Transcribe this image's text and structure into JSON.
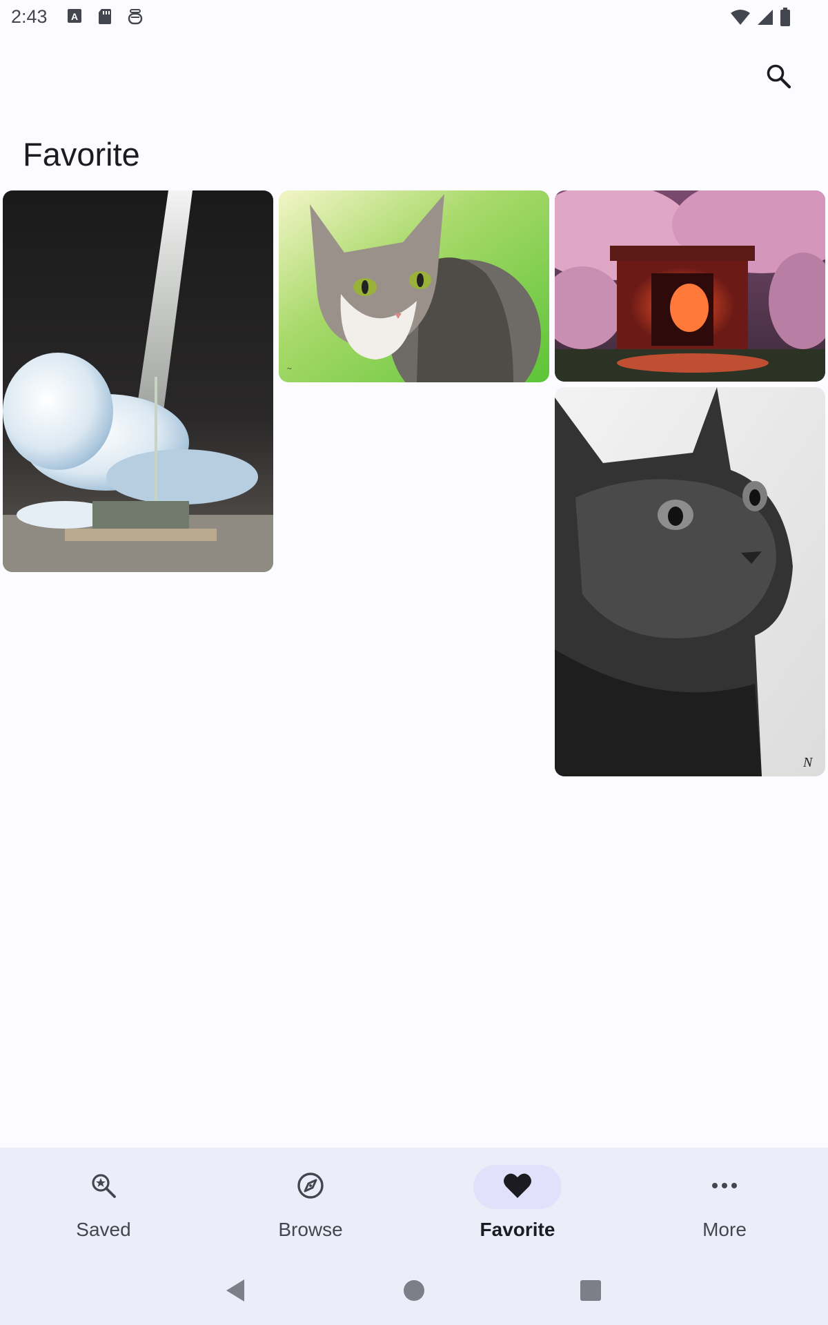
{
  "status_bar": {
    "time": "2:43",
    "left_icons": [
      "a-icon",
      "sd-card-icon",
      "vpn-icon"
    ],
    "right_icons": [
      "wifi-icon",
      "signal-icon",
      "battery-icon"
    ]
  },
  "header": {
    "title": "Favorite",
    "search_icon": "search-icon"
  },
  "gallery": {
    "items": [
      {
        "name": "gallery-item-white-lion",
        "subject": "white winged lion in light beam"
      },
      {
        "name": "gallery-item-tabby-cat",
        "subject": "tabby cat on green grass"
      },
      {
        "name": "gallery-item-shrine-blossoms",
        "subject": "red shrine gate with cherry blossoms"
      },
      {
        "name": "gallery-item-black-cat",
        "subject": "black cat looking up"
      }
    ]
  },
  "bottom_nav": {
    "items": [
      {
        "label": "Saved",
        "icon": "saved-search-icon",
        "active": false
      },
      {
        "label": "Browse",
        "icon": "compass-icon",
        "active": false
      },
      {
        "label": "Favorite",
        "icon": "heart-icon",
        "active": true
      },
      {
        "label": "More",
        "icon": "more-horiz-icon",
        "active": false
      }
    ]
  },
  "system_nav": [
    "back-icon",
    "home-icon",
    "recents-icon"
  ],
  "colors": {
    "background": "#fcfbff",
    "nav_background": "#ebeef9",
    "active_indicator": "#e2e1fb",
    "text_primary": "#1b1b21",
    "text_secondary": "#44464f"
  }
}
